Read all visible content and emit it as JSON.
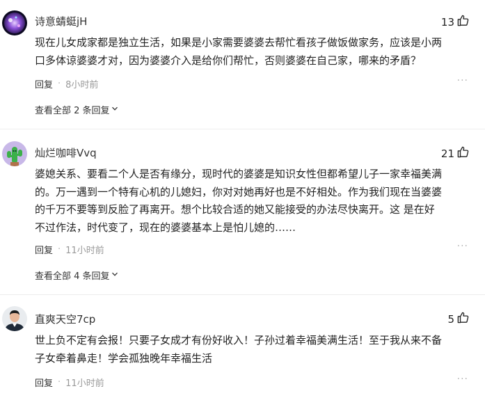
{
  "colors": {
    "text": "#222222",
    "secondary_text": "#999999",
    "background": "#ffffff",
    "divider": "#ededed"
  },
  "comments": [
    {
      "username": "诗意蜻蜓jH",
      "avatar_icon": "avatar-purple-sphere",
      "likes": "13",
      "lines": [
        "现在儿女成家都是独立生活，如果是小家需要婆婆去帮忙看孩子做饭做家务，应该是小两",
        "口多体谅婆婆才对，因为婆婆介入是给你们帮忙，否则婆婆在自己家，哪来的矛盾？"
      ],
      "reply_label": "回复",
      "time": "8小时前",
      "view_replies": "查看全部 2 条回复"
    },
    {
      "username": "灿烂咖啡Vvq",
      "avatar_icon": "avatar-green-cactus",
      "likes": "21",
      "lines": [
        "婆媳关系、要看二个人是否有缘分，现时代的婆婆是知识女性但都希望儿子一家幸福美满",
        "的。万一遇到一个特有心机的儿媳妇，你对对她再好也是不好相处。作为我们现在当婆婆",
        "的千万不要等到反脸了再离开。想个比较合适的她又能接受的办法尽快离开。这 是在好",
        "不过作法，时代变了，现在的婆婆基本上是怕儿媳的……"
      ],
      "reply_label": "回复",
      "time": "11小时前",
      "view_replies": "查看全部 4 条回复"
    },
    {
      "username": "直爽天空7cp",
      "avatar_icon": "avatar-man-portrait",
      "likes": "5",
      "lines": [
        "世上负不定有会报！只要子女成才有份好收入！子孙过着幸福美满生活！至于我从来不备",
        "子女牵着鼻走！学会孤独晚年幸福生活"
      ],
      "reply_label": "回复",
      "time": "11小时前",
      "view_replies": ""
    }
  ],
  "more_icon": "ellipsis-icon",
  "like_icon": "thumbs-up-icon",
  "expand_icon": "chevron-down-icon"
}
